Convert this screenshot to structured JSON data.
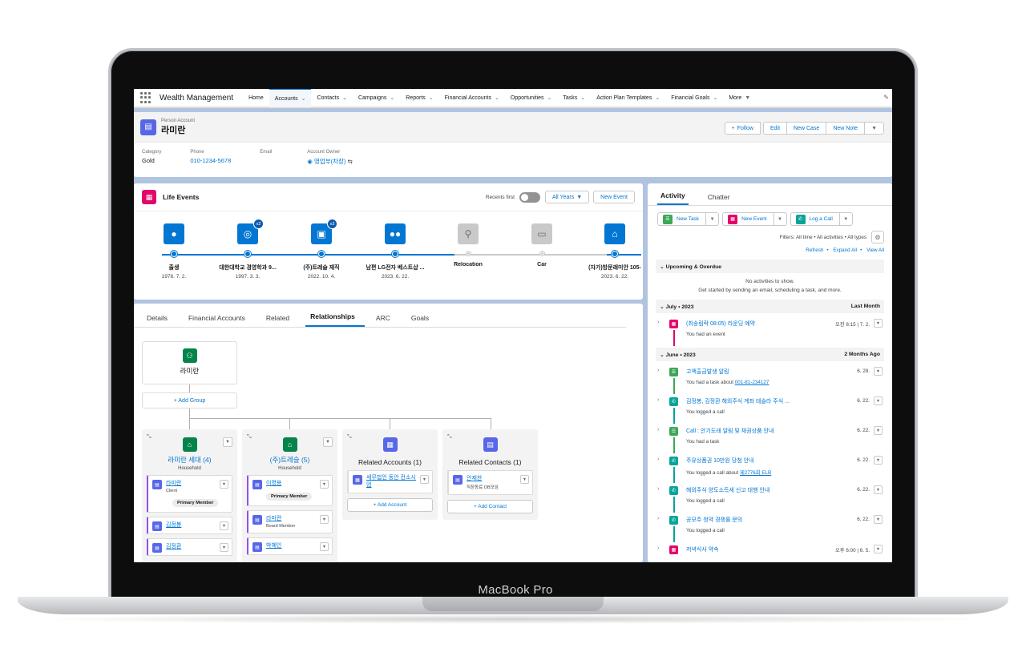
{
  "device": {
    "label": "MacBook Pro"
  },
  "nav": {
    "app_name": "Wealth Management",
    "items": [
      "Home",
      "Accounts",
      "Contacts",
      "Campaigns",
      "Reports",
      "Financial Accounts",
      "Opportunities",
      "Tasks",
      "Action Plan Templates",
      "Financial Goals",
      "More"
    ]
  },
  "header": {
    "object_type": "Person Account",
    "name": "라미란",
    "actions": {
      "follow": "Follow",
      "edit": "Edit",
      "new_case": "New Case",
      "new_note": "New Note"
    },
    "fields": {
      "category_label": "Category",
      "category_value": "Gold",
      "phone_label": "Phone",
      "phone_value": "010-1234-5678",
      "email_label": "Email",
      "owner_label": "Account Owner",
      "owner_value": "영업부(차장)"
    }
  },
  "life_events": {
    "title": "Life Events",
    "recents_label": "Recents first",
    "filter": "All Years",
    "new_event": "New Event",
    "events": [
      {
        "name": "출생",
        "date": "1978. 7. 2.",
        "badge": ""
      },
      {
        "name": "대한대학교 경영학과 9...",
        "date": "1997. 3. 3.",
        "badge": "x2"
      },
      {
        "name": "(주)트레슬 재직",
        "date": "2022. 10. 4.",
        "badge": "x3"
      },
      {
        "name": "남편 LG전자 베스트샵 ...",
        "date": "2023. 6. 22.",
        "badge": ""
      },
      {
        "name": "Relocation",
        "date": "",
        "badge": ""
      },
      {
        "name": "Car",
        "date": "",
        "badge": ""
      },
      {
        "name": "(자가)방문래미안 105-",
        "date": "2023. 6. 22.",
        "badge": ""
      }
    ]
  },
  "tabs": [
    "Details",
    "Financial Accounts",
    "Related",
    "Relationships",
    "ARC",
    "Goals"
  ],
  "relationships": {
    "root": "라미란",
    "add_group": "+ Add Group",
    "household1": {
      "title": "라미란 세대 (4)",
      "sub": "Household",
      "members": [
        {
          "name": "라미란",
          "role": "Client",
          "badge": "Primary Member"
        },
        {
          "name": "김정봉",
          "role": "",
          "badge": ""
        },
        {
          "name": "김정환",
          "role": "",
          "badge": ""
        }
      ]
    },
    "household2": {
      "title": "(주)트레슬 (5)",
      "sub": "Household",
      "members": [
        {
          "name": "이명용",
          "role": "",
          "badge": "Primary Member"
        },
        {
          "name": "라미란",
          "role": "Board Member",
          "badge": ""
        },
        {
          "name": "박혜인",
          "role": "",
          "badge": ""
        }
      ]
    },
    "related_accounts": {
      "title": "Related Accounts (1)",
      "item": "세무법인 동안 컨소시엄",
      "add": "+ Add Account"
    },
    "related_contacts": {
      "title": "Related Contacts (1)",
      "item": "안제찬",
      "item_role": "직장동료 OB모임",
      "add": "+ Add Contact"
    }
  },
  "activity": {
    "tabs": [
      "Activity",
      "Chatter"
    ],
    "buttons": [
      "New Task",
      "New Event",
      "Log a Call"
    ],
    "filters": "Filters: All time • All activities • All types",
    "links": [
      "Refresh",
      "Expand All",
      "View All"
    ],
    "upcoming": "Upcoming & Overdue",
    "empty1": "No activities to show.",
    "empty2": "Get started by sending an email, scheduling a task, and more.",
    "july": {
      "label": "July • 2023",
      "right": "Last Month"
    },
    "june": {
      "label": "June • 2023",
      "right": "2 Months Ago"
    },
    "items": [
      {
        "subject": "(취송림락 08:05) 라운딩 예약",
        "desc": "You had an event",
        "link": "",
        "date": "오전 8:15 | 7. 2.",
        "type": "event"
      },
      {
        "subject": "고액출금발생 알림",
        "desc": "You had a task about ",
        "link": "001-81-234127",
        "date": "6. 28.",
        "type": "task"
      },
      {
        "subject": "김정봉, 김정환 해외주식 계좌 테슬라 주식 ...",
        "desc": "You logged a call",
        "link": "",
        "date": "6. 22.",
        "type": "call"
      },
      {
        "subject": "Call : 안기도래 알림 및 채권상품 안내",
        "desc": "You had a task",
        "link": "",
        "date": "6. 22.",
        "type": "task"
      },
      {
        "subject": "주유상품권 10만원 당첨 안내",
        "desc": "You logged a call about ",
        "link": "제2776회 ELB",
        "date": "6. 22.",
        "type": "call"
      },
      {
        "subject": "해외주식 양도소득세 신고 대행 안내",
        "desc": "You logged a call",
        "link": "",
        "date": "6. 22.",
        "type": "call"
      },
      {
        "subject": "공모주 청약 경쟁률 문의",
        "desc": "You logged a call",
        "link": "",
        "date": "6. 22.",
        "type": "call"
      },
      {
        "subject": "저녁식사 약속",
        "desc": "",
        "link": "",
        "date": "오후 6:00 | 6. 5.",
        "type": "event"
      }
    ]
  },
  "colors": {
    "brand": "#0176d3",
    "event": "#e3066a",
    "task": "#3ba755",
    "call": "#06a59a",
    "account": "#5867e8"
  }
}
